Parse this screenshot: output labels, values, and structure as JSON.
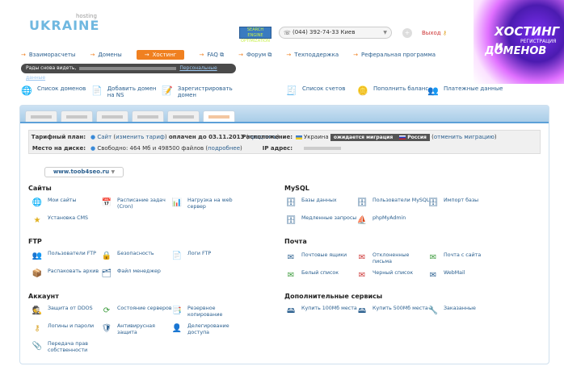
{
  "logo": {
    "main": "UKRAINE",
    "sub": "hosting"
  },
  "seal": {
    "line1": "SEARCH",
    "line2": "ENGINE",
    "line3": "OPTIMIZATION"
  },
  "header": {
    "phone": "(044) 392-74-33 Киев",
    "logout": "Выход"
  },
  "brand": {
    "line1": "ХОСТИНГ и",
    "line2": "РЕГИСТРАЦИЯ",
    "line3": "ДОМЕНОВ"
  },
  "nav": [
    {
      "label": "Взаиморасчеты"
    },
    {
      "label": "Домены"
    },
    {
      "label": "Хостинг"
    },
    {
      "label": "FAQ"
    },
    {
      "label": "Форум"
    },
    {
      "label": "Техподдержка"
    },
    {
      "label": "Реферальная программа"
    }
  ],
  "welcome": {
    "text": "Рады снова видеть,",
    "personal": "Персональные данные"
  },
  "quick": [
    {
      "label": "Список доменов"
    },
    {
      "label": "Добавить домен на NS"
    },
    {
      "label": "Зарегистрировать домен"
    },
    {
      "label": "Список счетов"
    },
    {
      "label": "Пополнить баланс"
    },
    {
      "label": "Платежные данные"
    }
  ],
  "info": {
    "plan_label": "Тарифный план:",
    "plan_value": "Сайт",
    "plan_change": "изменить тариф",
    "plan_paid": "оплачен до 03.11.2013",
    "plan_extend": "продлить",
    "location_label": "Расположение:",
    "location_value": "Украина",
    "migration_badge": "ожидается миграция",
    "migration_target": "Россия",
    "migration_cancel": "отменить миграцию",
    "disk_label": "Место на диске:",
    "disk_value": "Свободно: 464 Мб и 498500 файлов",
    "disk_more": "подробнее",
    "ip_label": "IP адрес:"
  },
  "domain_select": "www.toob4seo.ru",
  "sections": {
    "sites": {
      "title": "Сайты",
      "items": [
        "Мои сайты",
        "Расписание задач (Cron)",
        "Нагрузка на web сервер",
        "Установка CMS"
      ]
    },
    "ftp": {
      "title": "FTP",
      "items": [
        "Пользователи FTP",
        "Безопасность",
        "Логи FTP",
        "Распаковать архив",
        "Файл менеджер"
      ]
    },
    "account": {
      "title": "Аккаунт",
      "items": [
        "Защита от DDOS",
        "Состояние серверов",
        "Резервное копирование",
        "Логины и пароли",
        "Антивирусная защита",
        "Делегирование доступа",
        "Передача прав собственности"
      ]
    },
    "mysql": {
      "title": "MySQL",
      "items": [
        "Базы данных",
        "Пользователи MySQL",
        "Импорт базы",
        "Медленные запросы",
        "phpMyAdmin"
      ]
    },
    "mail": {
      "title": "Почта",
      "items": [
        "Почтовые ящики",
        "Отклоненные письма",
        "Почта с сайта",
        "Белый список",
        "Черный список",
        "WebMail"
      ]
    },
    "extra": {
      "title": "Дополнительные сервисы",
      "items": [
        "Купить 100Мб места",
        "Купить 500Мб места",
        "Заказанные"
      ]
    }
  }
}
